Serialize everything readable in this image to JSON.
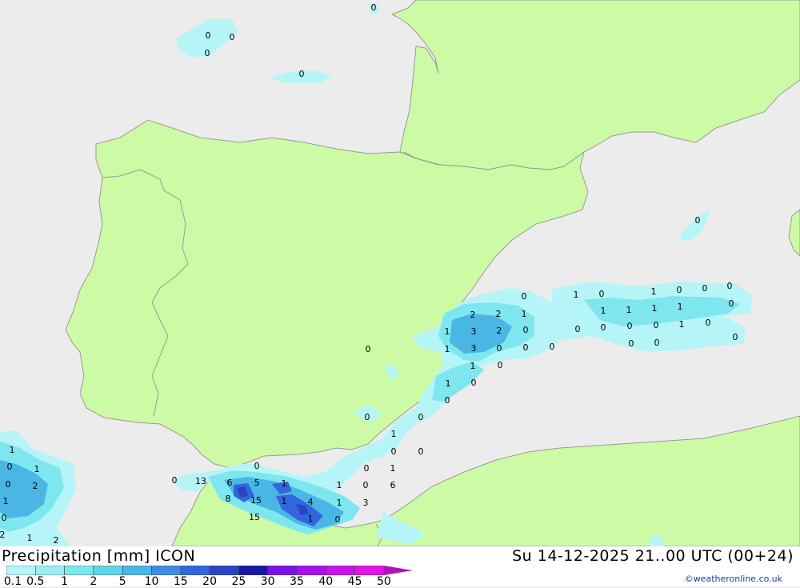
{
  "title": "Precipitation [mm] ICON",
  "valid_time": "Su 14-12-2025 21..00 UTC (00+24)",
  "credit": "©weatheronline.co.uk",
  "colors": {
    "sea": "#ececec",
    "land": "#cdfaa5",
    "border": "#9a9a9a"
  },
  "legend": {
    "ticks": [
      "0.1",
      "0.5",
      "1",
      "2",
      "5",
      "10",
      "15",
      "20",
      "25",
      "30",
      "35",
      "40",
      "45",
      "50"
    ],
    "colors": [
      "#b6f5f7",
      "#9aeff2",
      "#7ee6ee",
      "#5fd6ea",
      "#4ab6e6",
      "#3f8de2",
      "#3366dc",
      "#2a44c6",
      "#1818a6",
      "#7a12e6",
      "#a612ee",
      "#c814ee",
      "#e214e6",
      "#b010b8"
    ]
  },
  "labels": [
    {
      "v": "0",
      "c": "bay-1"
    },
    {
      "v": "0",
      "c": "bay-2"
    },
    {
      "v": "0",
      "c": "bay-3"
    },
    {
      "v": "0",
      "c": "bay-4"
    },
    {
      "v": "0",
      "c": "bay-5"
    },
    {
      "v": "0",
      "c": "sard"
    },
    {
      "v": "0",
      "c": "bal-1"
    },
    {
      "v": "1",
      "c": "bal-2"
    },
    {
      "v": "0",
      "c": "bal-3"
    },
    {
      "v": "1",
      "c": "bal-4"
    },
    {
      "v": "0",
      "c": "bal-5"
    },
    {
      "v": "0",
      "c": "bal-6"
    },
    {
      "v": "0",
      "c": "bal-7"
    },
    {
      "v": "1",
      "c": "bal-8"
    },
    {
      "v": "1",
      "c": "bal-9"
    },
    {
      "v": "1",
      "c": "bal-10"
    },
    {
      "v": "1",
      "c": "bal-11"
    },
    {
      "v": "0",
      "c": "bal-12"
    },
    {
      "v": "2",
      "c": "val-1"
    },
    {
      "v": "2",
      "c": "val-2"
    },
    {
      "v": "1",
      "c": "val-3"
    },
    {
      "v": "0",
      "c": "bal-13"
    },
    {
      "v": "0",
      "c": "bal-14"
    },
    {
      "v": "0",
      "c": "bal-15"
    },
    {
      "v": "0",
      "c": "bal-16"
    },
    {
      "v": "1",
      "c": "bal-17"
    },
    {
      "v": "0",
      "c": "bal-18"
    },
    {
      "v": "0",
      "c": "bal-19"
    },
    {
      "v": "1",
      "c": "val-4"
    },
    {
      "v": "3",
      "c": "val-5"
    },
    {
      "v": "2",
      "c": "val-6"
    },
    {
      "v": "0",
      "c": "val-7"
    },
    {
      "v": "0",
      "c": "bal-20"
    },
    {
      "v": "0",
      "c": "bal-21"
    },
    {
      "v": "1",
      "c": "val-8"
    },
    {
      "v": "3",
      "c": "val-9"
    },
    {
      "v": "0",
      "c": "val-10"
    },
    {
      "v": "0",
      "c": "val-11"
    },
    {
      "v": "0",
      "c": "val-12"
    },
    {
      "v": "0",
      "c": "mad"
    },
    {
      "v": "1",
      "c": "mur-1"
    },
    {
      "v": "0",
      "c": "mur-2"
    },
    {
      "v": "1",
      "c": "mur-3"
    },
    {
      "v": "0",
      "c": "mur-4"
    },
    {
      "v": "0",
      "c": "mur-5"
    },
    {
      "v": "0",
      "c": "and-1"
    },
    {
      "v": "0",
      "c": "and-2"
    },
    {
      "v": "1",
      "c": "and-3"
    },
    {
      "v": "0",
      "c": "and-4"
    },
    {
      "v": "0",
      "c": "and-5"
    },
    {
      "v": "0",
      "c": "and-6"
    },
    {
      "v": "1",
      "c": "and-7"
    },
    {
      "v": "1",
      "c": "atl-1"
    },
    {
      "v": "0",
      "c": "atl-2"
    },
    {
      "v": "1",
      "c": "atl-3"
    },
    {
      "v": "0",
      "c": "atl-4"
    },
    {
      "v": "2",
      "c": "atl-5"
    },
    {
      "v": "1",
      "c": "atl-6"
    },
    {
      "v": "0",
      "c": "atl-7"
    },
    {
      "v": "2",
      "c": "atl-8"
    },
    {
      "v": "1",
      "c": "atl-9"
    },
    {
      "v": "2",
      "c": "atl-10"
    },
    {
      "v": "0",
      "c": "gib-1"
    },
    {
      "v": "0",
      "c": "gib-2"
    },
    {
      "v": "13",
      "c": "gib-3"
    },
    {
      "v": "6",
      "c": "gib-4"
    },
    {
      "v": "5",
      "c": "gib-5"
    },
    {
      "v": "1",
      "c": "alb-1"
    },
    {
      "v": "1",
      "c": "alb-2"
    },
    {
      "v": "0",
      "c": "alb-3"
    },
    {
      "v": "6",
      "c": "gib-6"
    },
    {
      "v": "8",
      "c": "gib-7"
    },
    {
      "v": "15",
      "c": "gib-8"
    },
    {
      "v": "1",
      "c": "gib-9"
    },
    {
      "v": "4",
      "c": "gib-10"
    },
    {
      "v": "1",
      "c": "gib-11"
    },
    {
      "v": "3",
      "c": "gib-12"
    },
    {
      "v": "15",
      "c": "gib-13"
    },
    {
      "v": "1",
      "c": "gib-14"
    },
    {
      "v": "0",
      "c": "gib-15"
    }
  ]
}
